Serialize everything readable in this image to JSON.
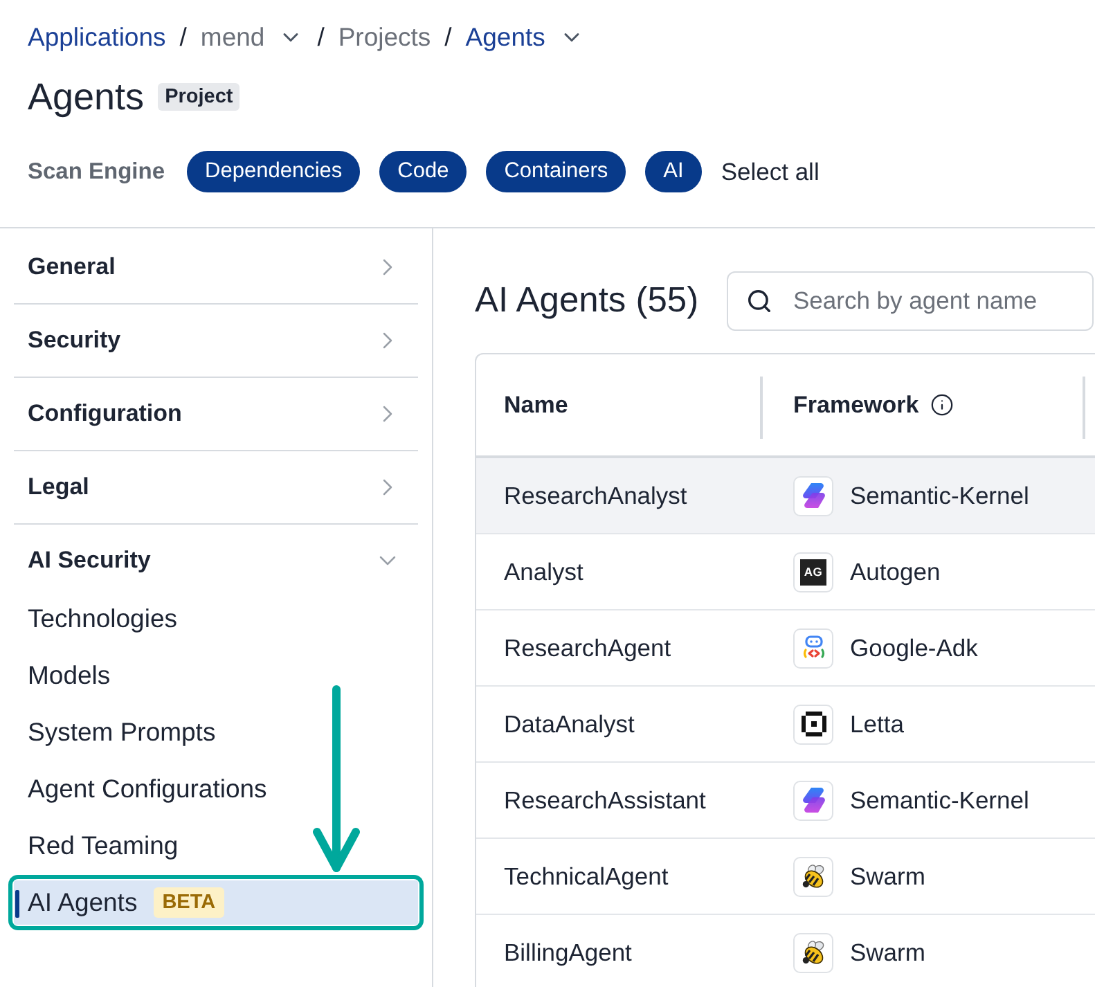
{
  "breadcrumb": [
    {
      "kind": "link",
      "label": "Applications",
      "dropdown": false
    },
    {
      "kind": "separator",
      "label": "/"
    },
    {
      "kind": "muted",
      "label": "mend",
      "dropdown": true
    },
    {
      "kind": "separator",
      "label": "/"
    },
    {
      "kind": "muted",
      "label": "Projects",
      "dropdown": false
    },
    {
      "kind": "separator",
      "label": "/"
    },
    {
      "kind": "link",
      "label": "Agents",
      "dropdown": true
    }
  ],
  "page": {
    "title": "Agents",
    "badge": "Project"
  },
  "scan_engine": {
    "label": "Scan Engine",
    "options": [
      {
        "label": "Dependencies",
        "selected": true
      },
      {
        "label": "Code",
        "selected": true
      },
      {
        "label": "Containers",
        "selected": true
      },
      {
        "label": "AI",
        "selected": true
      }
    ],
    "select_all": "Select all"
  },
  "sidebar": {
    "sections": [
      {
        "label": "General",
        "expanded": false
      },
      {
        "label": "Security",
        "expanded": false
      },
      {
        "label": "Configuration",
        "expanded": false
      },
      {
        "label": "Legal",
        "expanded": false
      },
      {
        "label": "AI Security",
        "expanded": true,
        "items": [
          {
            "label": "Technologies",
            "selected": false,
            "annotated": false
          },
          {
            "label": "Models",
            "selected": false,
            "annotated": false
          },
          {
            "label": "System Prompts",
            "selected": false,
            "annotated": false
          },
          {
            "label": "Agent Configurations",
            "selected": false,
            "annotated": false
          },
          {
            "label": "Red Teaming",
            "selected": false,
            "annotated": false
          },
          {
            "label": "AI Agents",
            "selected": true,
            "annotated": true,
            "badge": "BETA"
          }
        ]
      }
    ]
  },
  "agents": {
    "title": "AI Agents (55)",
    "search": {
      "placeholder": "Search by agent name"
    },
    "table": {
      "columns": [
        {
          "label": "Name",
          "info": false
        },
        {
          "label": "Framework",
          "info": true
        }
      ],
      "rows": [
        {
          "name": "ResearchAnalyst",
          "framework": {
            "label": "Semantic-Kernel",
            "kind": "ribbon"
          },
          "hovered": true
        },
        {
          "name": "Analyst",
          "framework": {
            "label": "Autogen",
            "kind": "monogram",
            "monogram": "AG"
          },
          "hovered": false
        },
        {
          "name": "ResearchAgent",
          "framework": {
            "label": "Google-Adk",
            "kind": "robot"
          },
          "hovered": false
        },
        {
          "name": "DataAnalyst",
          "framework": {
            "label": "Letta",
            "kind": "frame"
          },
          "hovered": false
        },
        {
          "name": "ResearchAssistant",
          "framework": {
            "label": "Semantic-Kernel",
            "kind": "ribbon"
          },
          "hovered": false
        },
        {
          "name": "TechnicalAgent",
          "framework": {
            "label": "Swarm",
            "kind": "bee"
          },
          "hovered": false
        },
        {
          "name": "BillingAgent",
          "framework": {
            "label": "Swarm",
            "kind": "bee"
          },
          "hovered": false
        }
      ]
    }
  }
}
